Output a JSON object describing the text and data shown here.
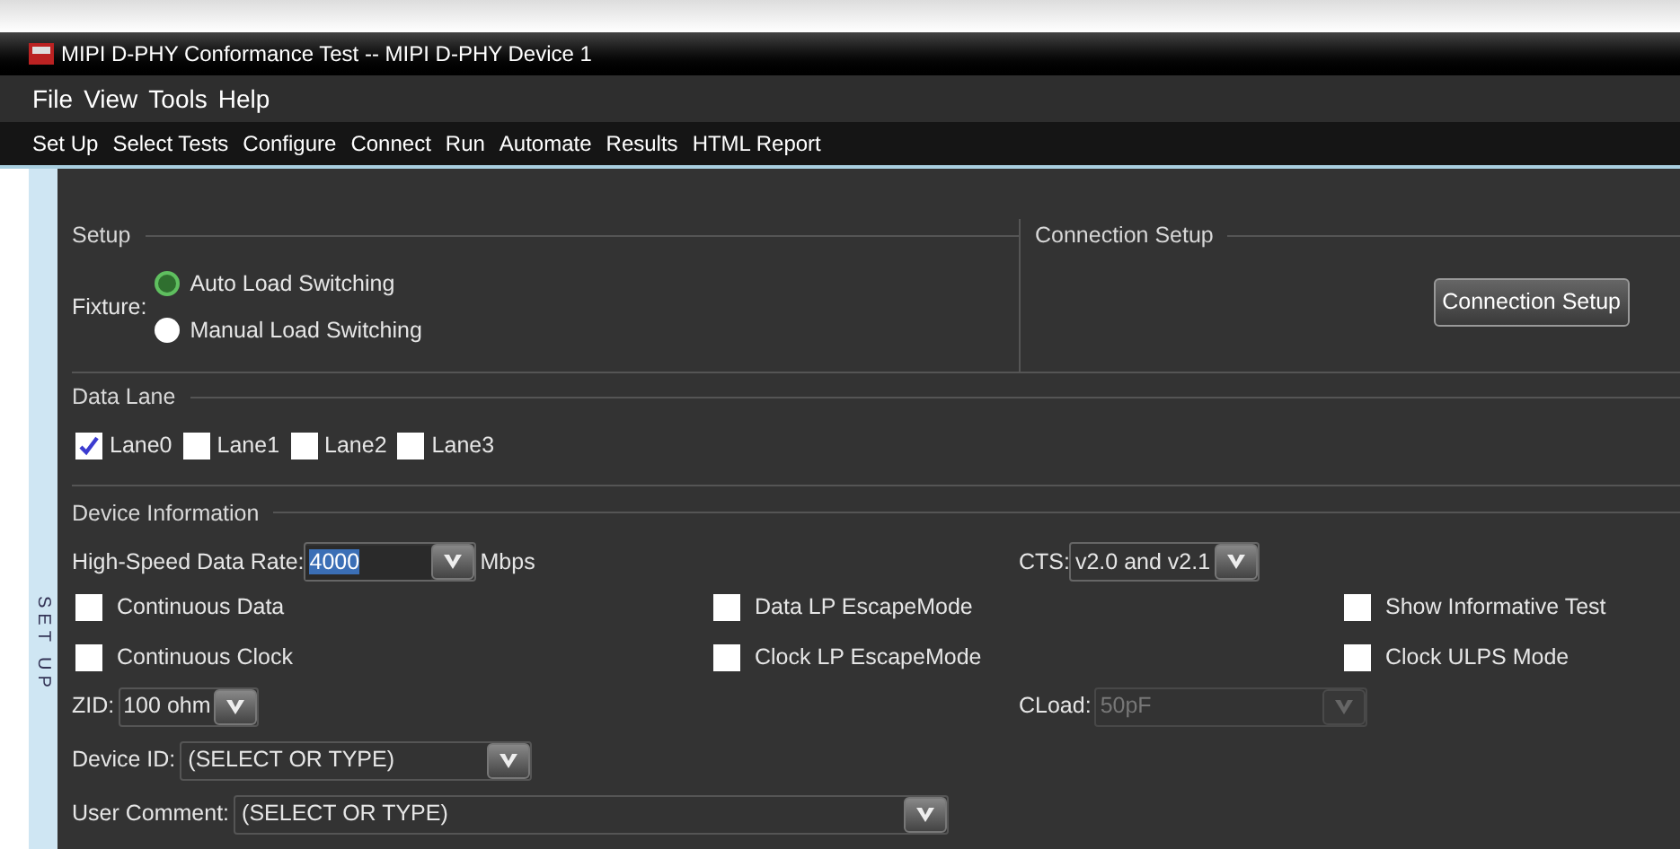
{
  "window": {
    "title": "MIPI D-PHY Conformance Test -- MIPI D-PHY Device 1"
  },
  "menu_bar": [
    "File",
    "View",
    "Tools",
    "Help"
  ],
  "toolbar": [
    "Set Up",
    "Select Tests",
    "Configure",
    "Connect",
    "Run",
    "Automate",
    "Results",
    "HTML Report"
  ],
  "side_tab": "SET UP",
  "setup": {
    "title": "Setup",
    "fixture_label": "Fixture:",
    "options": [
      {
        "label": "Auto Load Switching",
        "selected": true
      },
      {
        "label": "Manual Load Switching",
        "selected": false
      }
    ]
  },
  "connection_setup": {
    "title": "Connection Setup",
    "button": "Connection Setup"
  },
  "data_lane": {
    "title": "Data Lane",
    "lanes": [
      {
        "label": "Lane0",
        "checked": true
      },
      {
        "label": "Lane1",
        "checked": false
      },
      {
        "label": "Lane2",
        "checked": false
      },
      {
        "label": "Lane3",
        "checked": false
      }
    ]
  },
  "device_information": {
    "title": "Device Information",
    "data_rate": {
      "label": "High-Speed Data Rate:",
      "value": "4000",
      "unit": "Mbps"
    },
    "cts": {
      "label": "CTS:",
      "value": "v2.0 and v2.1"
    },
    "options": [
      {
        "label": "Continuous Data",
        "checked": false
      },
      {
        "label": "Data LP EscapeMode",
        "checked": false
      },
      {
        "label": "Show Informative Test",
        "checked": false
      },
      {
        "label": "Continuous Clock",
        "checked": false
      },
      {
        "label": "Clock LP EscapeMode",
        "checked": false
      },
      {
        "label": "Clock ULPS Mode",
        "checked": false
      }
    ],
    "zid": {
      "label": "ZID:",
      "value": "100 ohm"
    },
    "cload": {
      "label": "CLoad:",
      "value": "50pF",
      "disabled": true
    },
    "device_id": {
      "label": "Device ID:",
      "value": "(SELECT OR TYPE)"
    },
    "user_comment": {
      "label": "User Comment:",
      "value": "(SELECT OR TYPE)"
    }
  }
}
